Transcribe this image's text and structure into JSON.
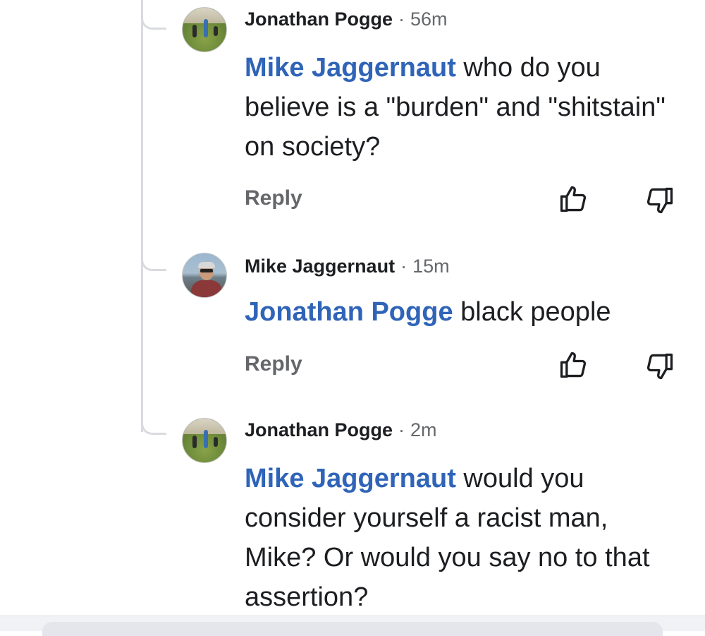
{
  "comments": [
    {
      "author": "Jonathan Pogge",
      "time": "56m",
      "mention": "Mike Jaggernaut",
      "text": " who do you believe is a \"burden\" and \"shitstain\" on society?",
      "reply_label": "Reply"
    },
    {
      "author": "Mike Jaggernaut",
      "time": "15m",
      "mention": "Jonathan Pogge",
      "text": " black people",
      "reply_label": "Reply"
    },
    {
      "author": "Jonathan Pogge",
      "time": "2m",
      "mention": "Mike Jaggernaut",
      "text": " would you consider yourself a racist man, Mike? Or would you say no to that assertion?"
    }
  ],
  "separator": "·",
  "icons": {
    "upvote": "thumbs-up-outline-icon",
    "downvote": "thumbs-down-outline-icon"
  },
  "colors": {
    "mention": "#2f64b8",
    "muted": "#65676b",
    "text": "#1c1e21",
    "thread_line": "#d9dbe0"
  }
}
